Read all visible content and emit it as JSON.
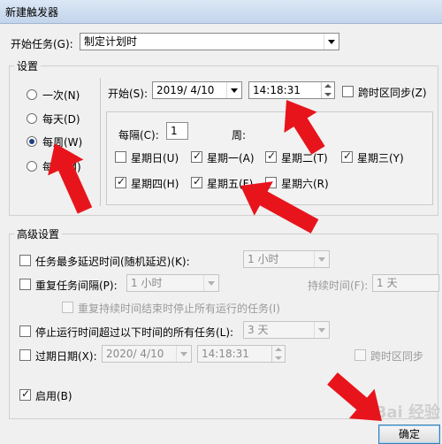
{
  "window": {
    "title": "新建触发器"
  },
  "start_task": {
    "label": "开始任务(G):",
    "value": "制定计划时"
  },
  "settings": {
    "legend": "设置",
    "radios": [
      {
        "label": "一次(N)",
        "selected": false
      },
      {
        "label": "每天(D)",
        "selected": false
      },
      {
        "label": "每周(W)",
        "selected": true
      },
      {
        "label": "每月(M)",
        "selected": false
      }
    ],
    "start_label": "开始(S):",
    "start_date": "2019/ 4/10",
    "start_time": "14:18:31",
    "sync_timezone_label": "跨时区同步(Z)",
    "recur_label": "每隔(C):",
    "recur_value": "1",
    "recur_unit": "周:",
    "weekdays": [
      {
        "label": "星期日(U)",
        "checked": false
      },
      {
        "label": "星期一(A)",
        "checked": true
      },
      {
        "label": "星期二(T)",
        "checked": true
      },
      {
        "label": "星期三(Y)",
        "checked": true
      },
      {
        "label": "星期四(H)",
        "checked": true
      },
      {
        "label": "星期五(F)",
        "checked": true
      },
      {
        "label": "星期六(R)",
        "checked": false
      }
    ]
  },
  "advanced": {
    "legend": "高级设置",
    "delay_label": "任务最多延迟时间(随机延迟)(K):",
    "delay_value": "1 小时",
    "repeat_label": "重复任务间隔(P):",
    "repeat_value": "1 小时",
    "duration_label": "持续时间(F):",
    "duration_value": "1 天",
    "stop_running_label": "重复持续时间结束时停止所有运行的任务(I)",
    "stop_label": "停止运行时间超过以下时间的所有任务(L):",
    "stop_value": "3 天",
    "expire_label": "过期日期(X):",
    "expire_date": "2020/ 4/10",
    "expire_time": "14:18:31",
    "expire_sync_label": "跨时区同步",
    "enabled_label": "启用(B)"
  },
  "buttons": {
    "ok": "确定"
  },
  "watermark": "Bai 经验",
  "colors": {
    "annotation_arrow": "#e8141c"
  }
}
